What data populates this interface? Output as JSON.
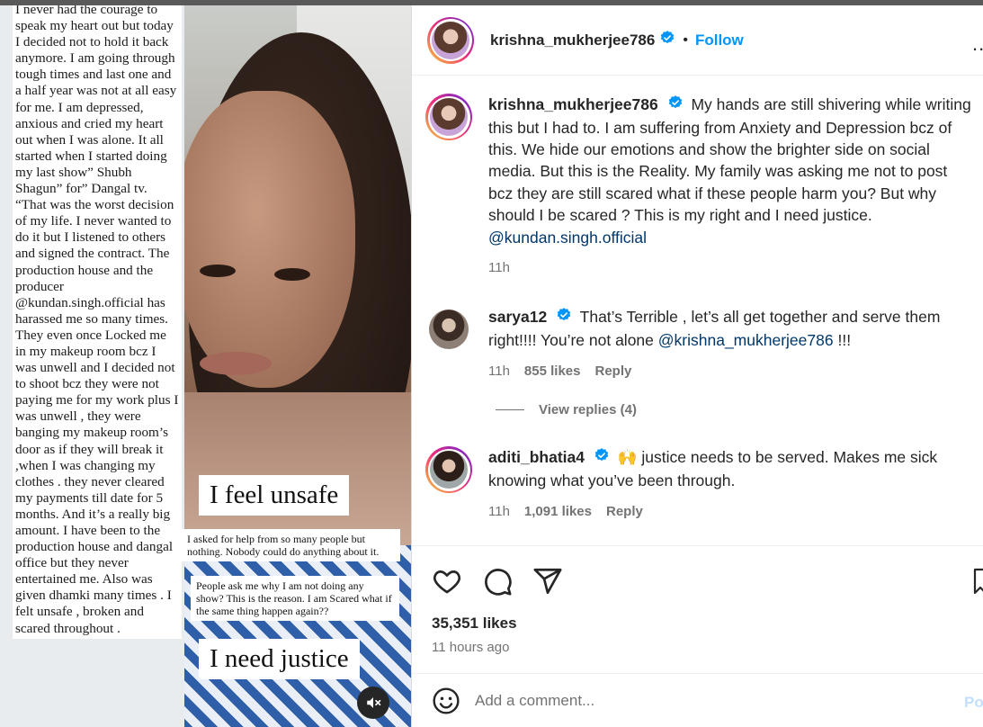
{
  "header": {
    "username": "krishna_mukherjee786",
    "separator": "•",
    "follow_label": "Follow",
    "more_label": "..."
  },
  "story": {
    "text": "I never had the courage to speak my heart out but today I decided not to hold it back anymore. I am going through tough times and last one and a half year was not at all easy for me. I am depressed, anxious and cried my heart out when I was alone. It all started when I started doing my last show” Shubh Shagun” for” Dangal tv. “That was the worst decision of my life. I never wanted to do it but I listened to others and signed the contract. The production house and the producer @kundan.singh.official has harassed me so many times. They even once Locked me in my makeup room bcz I was unwell and I decided not to shoot bcz they were not paying me for my work plus I was unwell , they were banging my makeup room’s door as if they will break it ,when I was changing my clothes . they never cleared my payments till date for 5 months. And it’s a really big amount. I have been to the production house and dangal office but they never entertained me. Also was given dhamki many times . I felt unsafe , broken and scared throughout .",
    "sticker_unsafe": "I feel unsafe",
    "sticker_help": "I asked for help from so many people but nothing. Nobody could do anything about it.",
    "sticker_ask": "People ask me why I am not doing any show? This is the reason. I am Scared what if the same thing happen again??",
    "sticker_justice": "I need justice"
  },
  "caption": {
    "username": "krishna_mukherjee786",
    "text": "My hands are still shivering while writing this but I had to. I am suffering from Anxiety and Depression bcz of this. We hide our emotions and show the brighter side on social media. But this is the Reality. My family was asking me not to post bcz they are still scared what if these people harm you? But why should I be scared ? This is my right and I need justice.",
    "mention": "@kundan.singh.official",
    "time": "11h"
  },
  "comments": [
    {
      "username": "sarya12",
      "text": "That’s Terrible , let’s all get together and serve them right!!!! You’re not alone",
      "mention": "@krishna_mukherjee786",
      "suffix": "!!!",
      "time": "11h",
      "likes": "855 likes",
      "reply_label": "Reply"
    },
    {
      "username": "aditi_bhatia4",
      "emoji": "🙌",
      "text": "justice needs to be served. Makes me sick knowing what you’ve been through.",
      "time": "11h",
      "likes": "1,091 likes",
      "reply_label": "Reply"
    }
  ],
  "view_replies": "View replies (4)",
  "post_stats": {
    "likes": "35,351 likes",
    "posted": "11 hours ago"
  },
  "add_comment": {
    "placeholder": "Add a comment...",
    "post_label": "Po"
  },
  "colors": {
    "accent": "#0095f6",
    "mention": "#00376b",
    "muted": "#737373",
    "text": "#262626"
  }
}
